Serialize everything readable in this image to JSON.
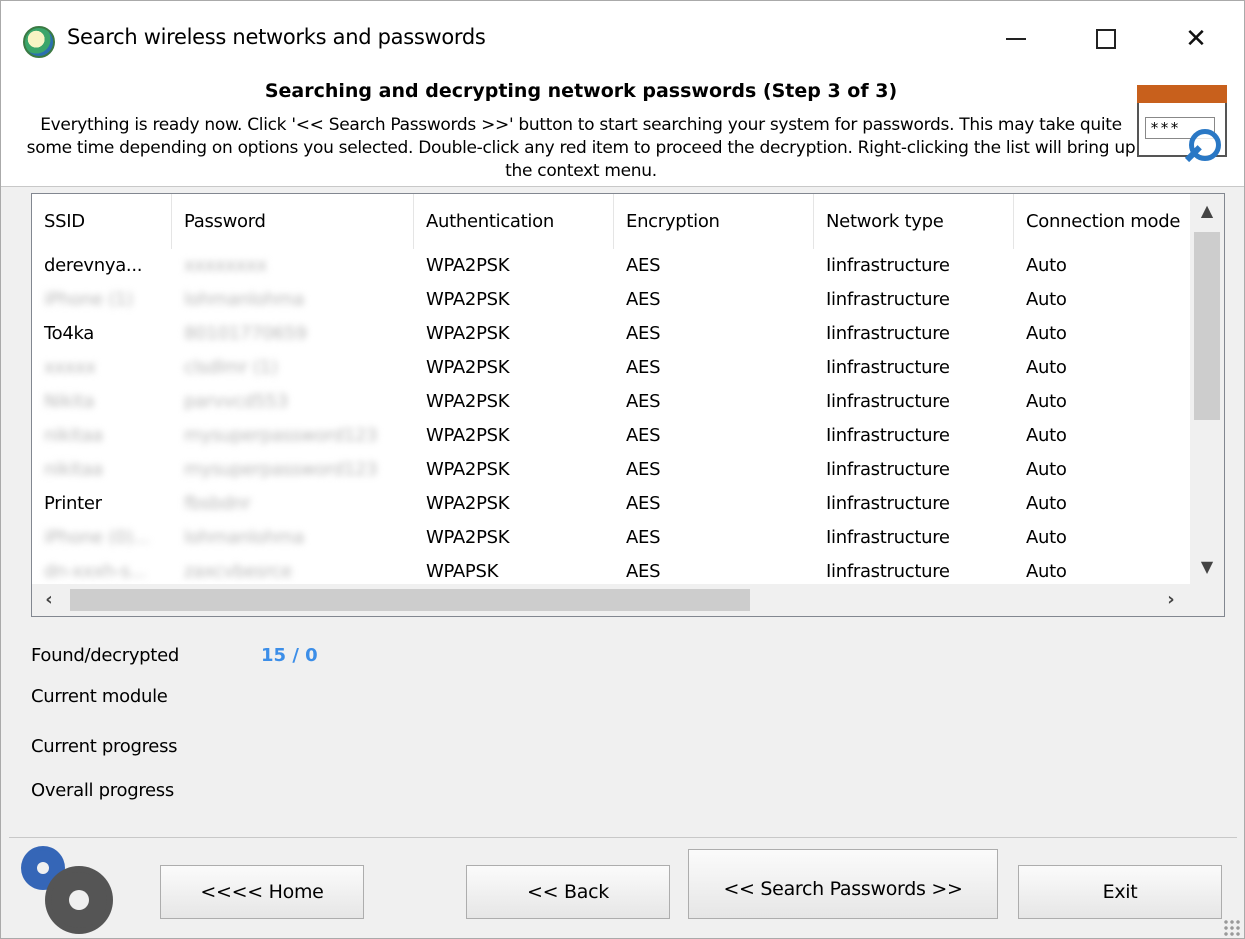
{
  "window": {
    "title": "Search wireless networks and passwords",
    "minimize_glyph": "—",
    "close_glyph": "✕"
  },
  "header": {
    "step_title": "Searching and decrypting network passwords (Step 3 of 3)",
    "description": "Everything is ready now. Click '<< Search Passwords >>' button to start searching your system for passwords. This may take quite some time depending on options you selected. Double-click any red item to proceed the decryption. Right-clicking the list will bring up the context menu.",
    "icon_text": "***"
  },
  "list": {
    "columns": [
      "SSID",
      "Password",
      "Authentication",
      "Encryption",
      "Network type",
      "Connection mode"
    ],
    "rows": [
      {
        "ssid": "derevnya...",
        "password": "xxxxxxxx",
        "auth": "WPA2PSK",
        "enc": "AES",
        "type": "Iinfrastructure",
        "mode": "Auto",
        "ssid_blur": false
      },
      {
        "ssid": "iPhone (1)",
        "password": "lohmanlohma",
        "auth": "WPA2PSK",
        "enc": "AES",
        "type": "Iinfrastructure",
        "mode": "Auto",
        "ssid_blur": true
      },
      {
        "ssid": "To4ka",
        "password": "80101770659",
        "auth": "WPA2PSK",
        "enc": "AES",
        "type": "Iinfrastructure",
        "mode": "Auto",
        "ssid_blur": false
      },
      {
        "ssid": "xxxxx",
        "password": "clsdlmr (1)",
        "auth": "WPA2PSK",
        "enc": "AES",
        "type": "Iinfrastructure",
        "mode": "Auto",
        "ssid_blur": true
      },
      {
        "ssid": "Nikita",
        "password": "parvvcd553",
        "auth": "WPA2PSK",
        "enc": "AES",
        "type": "Iinfrastructure",
        "mode": "Auto",
        "ssid_blur": true
      },
      {
        "ssid": "nikitaa",
        "password": "mysuperpassword123",
        "auth": "WPA2PSK",
        "enc": "AES",
        "type": "Iinfrastructure",
        "mode": "Auto",
        "ssid_blur": true
      },
      {
        "ssid": "nikitaa",
        "password": "mysuperpassword123",
        "auth": "WPA2PSK",
        "enc": "AES",
        "type": "Iinfrastructure",
        "mode": "Auto",
        "ssid_blur": true
      },
      {
        "ssid": "Printer",
        "password": "fbsbdnr",
        "auth": "WPA2PSK",
        "enc": "AES",
        "type": "Iinfrastructure",
        "mode": "Auto",
        "ssid_blur": false
      },
      {
        "ssid": "iPhone (0)...",
        "password": "lohmanlohma",
        "auth": "WPA2PSK",
        "enc": "AES",
        "type": "Iinfrastructure",
        "mode": "Auto",
        "ssid_blur": true
      },
      {
        "ssid": "dn-xxxh-s...",
        "password": "zaxcvbesrce",
        "auth": "WPAPSK",
        "enc": "AES",
        "type": "Iinfrastructure",
        "mode": "Auto",
        "ssid_blur": true
      }
    ]
  },
  "status": {
    "found_label": "Found/decrypted",
    "found_value": "15 / 0",
    "module_label": "Current module",
    "current_progress_label": "Current progress",
    "overall_progress_label": "Overall progress"
  },
  "buttons": {
    "home": "<<<< Home",
    "back": "<< Back",
    "search": "<< Search Passwords >>",
    "exit": "Exit"
  }
}
